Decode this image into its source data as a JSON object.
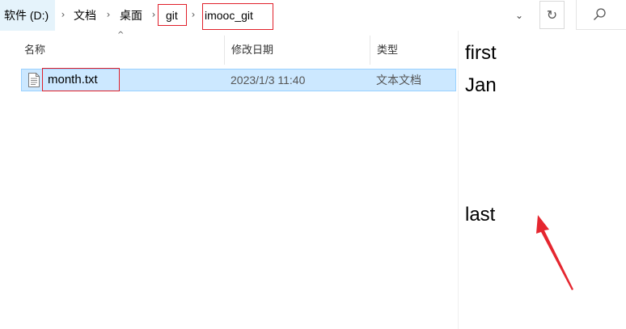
{
  "address": {
    "crumbs": [
      "软件 (D:)",
      "文档",
      "桌面",
      "git",
      "imooc_git"
    ],
    "separator": "›",
    "dropdown_glyph": "⌄",
    "refresh_glyph": "↻",
    "refresh_icon": "refresh-icon",
    "search_icon": "search-icon"
  },
  "columns": {
    "name": "名称",
    "modified": "修改日期",
    "type": "类型",
    "sort_glyph": "^"
  },
  "files": [
    {
      "name": "month.txt",
      "modified": "2023/1/3 11:40",
      "type": "文本文档",
      "icon": "text-file-icon",
      "selected": true
    }
  ],
  "preview": {
    "lines": [
      "first",
      "Jan",
      "last"
    ]
  },
  "annotations": {
    "highlight_color": "#e0202a",
    "arrow": "red-arrow"
  },
  "colors": {
    "selection": "#cce8ff",
    "selection_border": "#99d1ff",
    "crumb_hover": "#e5f3fb"
  }
}
